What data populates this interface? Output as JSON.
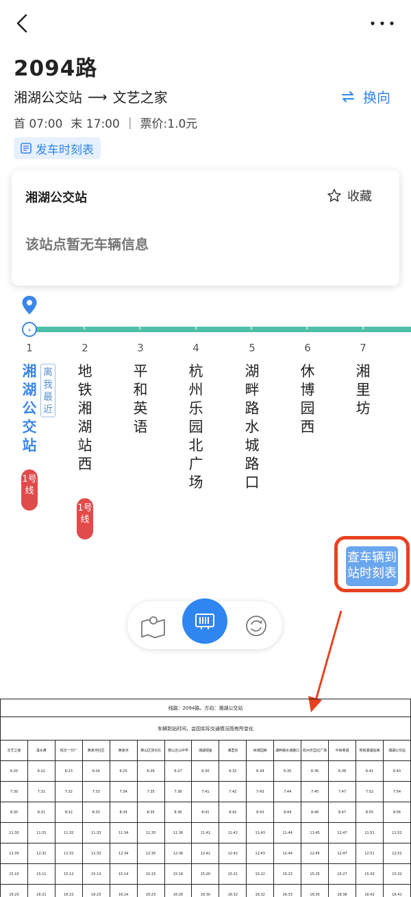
{
  "header": {
    "title": "2094路",
    "from": "湘湖公交站",
    "arrow": "⟶",
    "to": "文艺之家",
    "swap_label": "换向"
  },
  "meta": {
    "first": "首 07:00",
    "last": "末 17:00",
    "sep": "|",
    "price": "票价:1.0元"
  },
  "timetable_tag": "发车时刻表",
  "card": {
    "stop_name": "湘湖公交站",
    "favorite_label": "收藏",
    "no_vehicle": "该站点暂无车辆信息"
  },
  "stops": [
    {
      "num": "1",
      "name": "湘湖公交站"
    },
    {
      "num": "2",
      "name": "地铁湘湖站西"
    },
    {
      "num": "3",
      "name": "平和英语"
    },
    {
      "num": "4",
      "name": "杭州乐园北广场"
    },
    {
      "num": "5",
      "name": "湖畔路水城路口"
    },
    {
      "num": "6",
      "name": "休博园西"
    },
    {
      "num": "7",
      "name": "湘里坊"
    }
  ],
  "nearest_label": "离我最近",
  "metro_badge": "1号线",
  "query_button": "查车辆到站时刻表",
  "timetable": {
    "caption": "线路：2094路，方向：湘湖公交站",
    "subtitle": "车辆到站时间，会因实际交通情况而有所变化",
    "headers": [
      "文艺之家",
      "溪头黄",
      "杭氏一分厂",
      "黄家河社区",
      "黄家河",
      "萧山区测大队",
      "萧山五山中学",
      "湘湖观鱼",
      "湘里坊",
      "休博园西",
      "湖畔路水城路口",
      "杭州乐园北广场",
      "平和英语",
      "地铁湘湖站西",
      "湘湖公交站"
    ],
    "rows": [
      [
        "6:20",
        "6:22",
        "6:23",
        "6:24",
        "6:25",
        "6:26",
        "6:27",
        "6:30",
        "6:32",
        "6:34",
        "6:35",
        "6:36",
        "6:38",
        "6:41",
        "6:43"
      ],
      [
        "7:30",
        "7:31",
        "7:32",
        "7:33",
        "7:34",
        "7:35",
        "7:36",
        "7:41",
        "7:42",
        "7:43",
        "7:44",
        "7:45",
        "7:47",
        "7:52",
        "7:54"
      ],
      [
        "8:30",
        "8:31",
        "8:32",
        "8:33",
        "8:34",
        "8:35",
        "8:36",
        "8:41",
        "8:42",
        "8:43",
        "8:44",
        "8:46",
        "8:47",
        "8:55",
        "8:56"
      ],
      [
        "11:30",
        "11:31",
        "11:32",
        "11:33",
        "11:34",
        "11:35",
        "11:36",
        "11:41",
        "11:42",
        "11:43",
        "11:44",
        "11:45",
        "11:47",
        "11:51",
        "11:52"
      ],
      [
        "12:30",
        "12:31",
        "12:32",
        "12:33",
        "12:34",
        "12:35",
        "12:36",
        "12:41",
        "12:42",
        "12:43",
        "12:44",
        "12:45",
        "12:47",
        "12:51",
        "12:52"
      ],
      [
        "15:10",
        "15:11",
        "15:12",
        "15:13",
        "15:14",
        "15:15",
        "15:16",
        "15:20",
        "15:21",
        "15:22",
        "15:23",
        "15:25",
        "15:27",
        "15:30",
        "15:32"
      ],
      [
        "16:20",
        "16:21",
        "16:22",
        "16:23",
        "16:24",
        "16:25",
        "16:26",
        "16:30",
        "16:32",
        "16:32",
        "16:33",
        "16:35",
        "16:38",
        "16:42",
        "16:41"
      ]
    ]
  },
  "colors": {
    "accent": "#2f86f0",
    "line": "#4fbfa8",
    "metro": "#e04b4b",
    "highlight": "#e8411f"
  }
}
